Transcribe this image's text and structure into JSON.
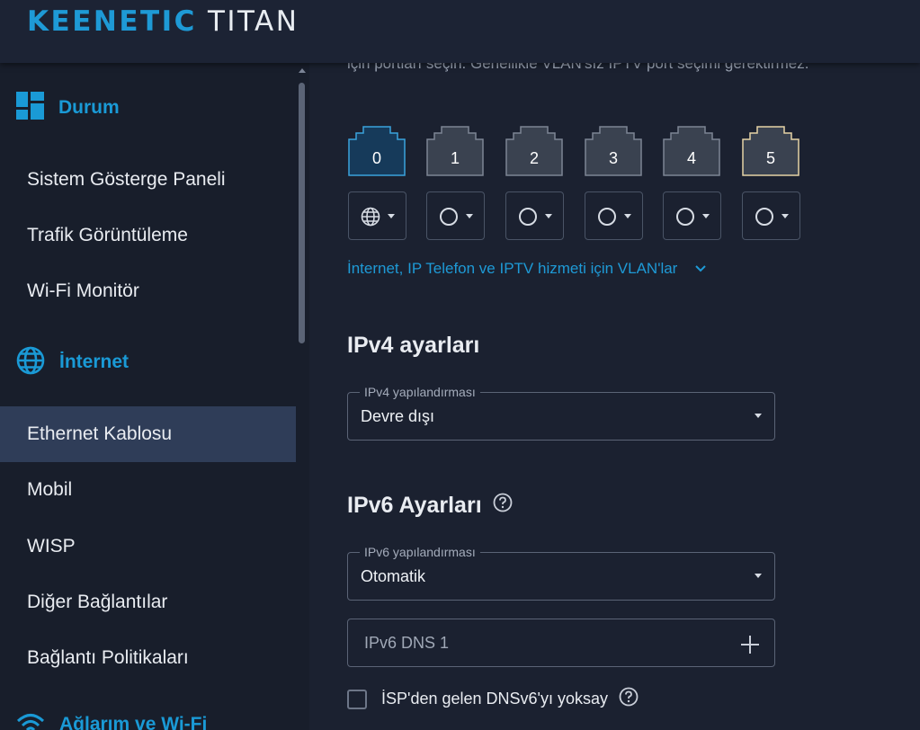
{
  "header": {
    "brand": "KEENETIC",
    "model": "TITAN"
  },
  "sidebar": {
    "sections": [
      {
        "label": "Durum",
        "icon": "dashboard-icon"
      },
      {
        "label": "İnternet",
        "icon": "globe-icon"
      },
      {
        "label": "Ağlarım ve Wi-Fi",
        "icon": "wifi-icon"
      }
    ],
    "items": [
      {
        "label": "Sistem Gösterge Paneli",
        "active": false
      },
      {
        "label": "Trafik Görüntüleme",
        "active": false
      },
      {
        "label": "Wi-Fi Monitör",
        "active": false
      },
      {
        "label": "Ethernet Kablosu",
        "active": true
      },
      {
        "label": "Mobil",
        "active": false
      },
      {
        "label": "WISP",
        "active": false
      },
      {
        "label": "Diğer Bağlantılar",
        "active": false
      },
      {
        "label": "Bağlantı Politikaları",
        "active": false
      }
    ]
  },
  "main": {
    "cut_text": "için portları seçin. Genellikle VLAN'sız IPTV port seçimi gerektirmez.",
    "ports": [
      {
        "label": "0",
        "state": "wan",
        "mode_icon": "globe-icon"
      },
      {
        "label": "1",
        "state": "normal",
        "mode_icon": "circle-icon"
      },
      {
        "label": "2",
        "state": "normal",
        "mode_icon": "circle-icon"
      },
      {
        "label": "3",
        "state": "normal",
        "mode_icon": "circle-icon"
      },
      {
        "label": "4",
        "state": "normal",
        "mode_icon": "circle-icon"
      },
      {
        "label": "5",
        "state": "highlight",
        "mode_icon": "circle-icon"
      }
    ],
    "vlan_link": "İnternet, IP Telefon ve IPTV hizmeti için VLAN'lar",
    "ipv4": {
      "title": "IPv4 ayarları",
      "field_label": "IPv4 yapılandırması",
      "value": "Devre dışı"
    },
    "ipv6": {
      "title": "IPv6 Ayarları",
      "field_label": "IPv6 yapılandırması",
      "value": "Otomatik",
      "dns_placeholder": "IPv6 DNS 1",
      "ignore_dns_label": "İSP'den gelen DNSv6'yı yoksay",
      "ignore_dns_checked": false
    }
  },
  "colors": {
    "accent": "#1e9ad6",
    "background": "#1b2130",
    "sidebar": "#181e2b",
    "active_item": "#2f3d58"
  }
}
